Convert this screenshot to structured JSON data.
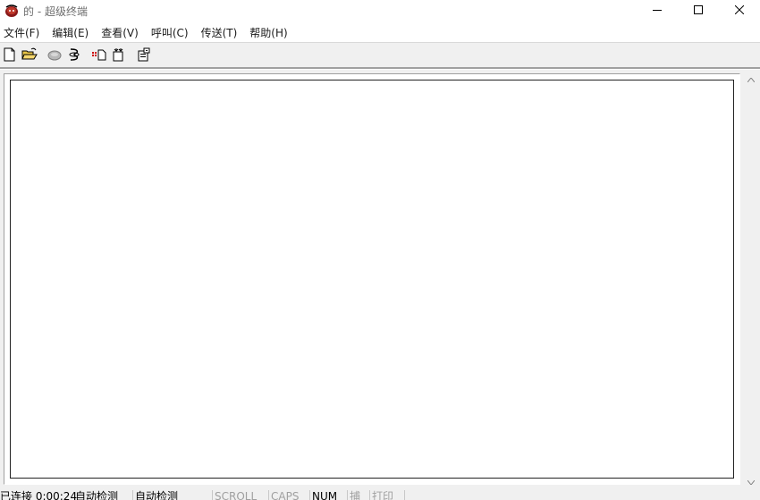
{
  "window": {
    "title": "的 - 超级终端",
    "icon": "hyperterminal-phone-icon",
    "controls": [
      "minimize-icon",
      "maximize-icon",
      "close-icon"
    ]
  },
  "menu": [
    "文件(F)",
    "编辑(E)",
    "查看(V)",
    "呼叫(C)",
    "传送(T)",
    "帮助(H)"
  ],
  "toolbar": {
    "buttons": [
      "new-icon",
      "open-icon",
      "call-icon",
      "disconnect-icon",
      "send-icon",
      "receive-icon",
      "properties-icon"
    ]
  },
  "statusbar": {
    "connection": "已连接 0:00:24",
    "detect1": "自动检测",
    "detect2": "自动检测",
    "scroll": "SCROLL",
    "caps": "CAPS",
    "num": "NUM",
    "capture": "捕",
    "print": "打印"
  },
  "colors": {
    "chrome": "#f0f0f0",
    "terminal_bg": "#ffffff",
    "disabled_text": "#a0a0a0"
  }
}
